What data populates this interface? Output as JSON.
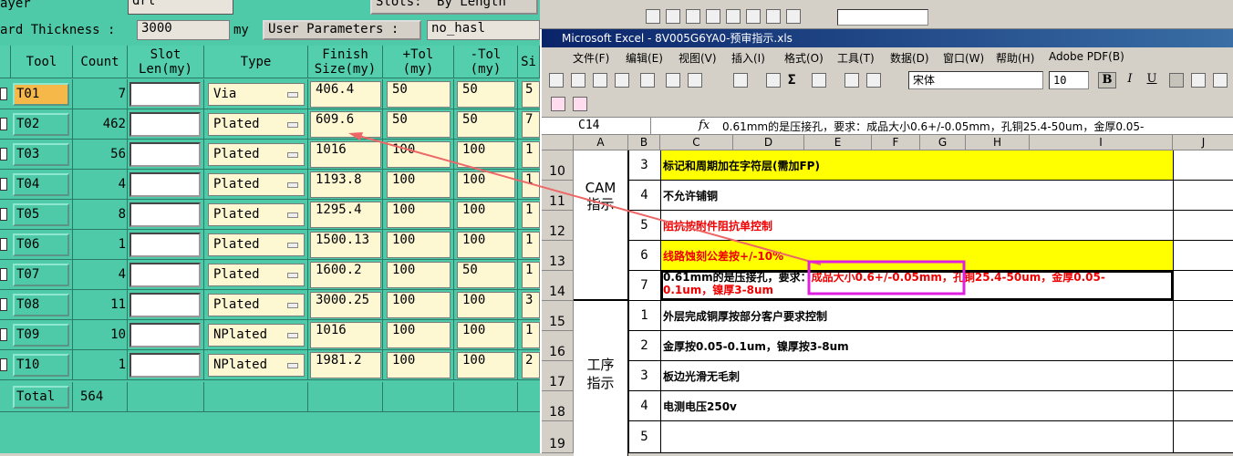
{
  "left_panel": {
    "layer_label": "ayer",
    "layer_value": "drl",
    "slots_label": "Slots:",
    "slots_value": "By Length",
    "board_thickness_label": "ard Thickness :",
    "board_thickness_value": "3000",
    "board_thickness_unit": "my",
    "user_params_label": "User Parameters :",
    "user_params_value": "no_hasl",
    "headers": [
      "Tool",
      "Count",
      "Slot\nLen(my)",
      "Type",
      "Finish\nSize(my)",
      "+Tol\n(my)",
      "-Tol\n(my)",
      "Si"
    ],
    "header_tool": "Tool",
    "header_count": "Count",
    "header_slot1": "Slot",
    "header_slot2": "Len(my)",
    "header_type": "Type",
    "header_finish1": "Finish",
    "header_finish2": "Size(my)",
    "header_ptol1": "+Tol",
    "header_ptol2": "(my)",
    "header_mtol1": "-Tol",
    "header_mtol2": "(my)",
    "header_si": "Si",
    "rows": [
      {
        "tool": "T01",
        "count": "7",
        "type": "Via",
        "finish": "406.4",
        "ptol": "50",
        "mtol": "50",
        "si": "5"
      },
      {
        "tool": "T02",
        "count": "462",
        "type": "Plated",
        "finish": "609.6",
        "ptol": "50",
        "mtol": "50",
        "si": "7"
      },
      {
        "tool": "T03",
        "count": "56",
        "type": "Plated",
        "finish": "1016",
        "ptol": "100",
        "mtol": "100",
        "si": "1"
      },
      {
        "tool": "T04",
        "count": "4",
        "type": "Plated",
        "finish": "1193.8",
        "ptol": "100",
        "mtol": "100",
        "si": "1"
      },
      {
        "tool": "T05",
        "count": "8",
        "type": "Plated",
        "finish": "1295.4",
        "ptol": "100",
        "mtol": "100",
        "si": "1"
      },
      {
        "tool": "T06",
        "count": "1",
        "type": "Plated",
        "finish": "1500.13",
        "ptol": "100",
        "mtol": "100",
        "si": "1"
      },
      {
        "tool": "T07",
        "count": "4",
        "type": "Plated",
        "finish": "1600.2",
        "ptol": "100",
        "mtol": "50",
        "si": "1"
      },
      {
        "tool": "T08",
        "count": "11",
        "type": "Plated",
        "finish": "3000.25",
        "ptol": "100",
        "mtol": "100",
        "si": "3"
      },
      {
        "tool": "T09",
        "count": "10",
        "type": "NPlated",
        "finish": "1016",
        "ptol": "100",
        "mtol": "100",
        "si": "1"
      },
      {
        "tool": "T10",
        "count": "1",
        "type": "NPlated",
        "finish": "1981.2",
        "ptol": "100",
        "mtol": "100",
        "si": "2"
      }
    ],
    "total_label": "Total",
    "total_value": "564"
  },
  "excel": {
    "title": "Microsoft Excel - 8V005G6YA0-预审指示.xls",
    "menu": [
      "文件(F)",
      "编辑(E)",
      "视图(V)",
      "插入(I)",
      "格式(O)",
      "工具(T)",
      "数据(D)",
      "窗口(W)",
      "帮助(H)",
      "Adobe PDF(B)"
    ],
    "font_name": "宋体",
    "font_size": "10",
    "cell_ref": "C14",
    "fx": "fx",
    "formula": "0.61mm的是压接孔，要求：成品大小0.6+/-0.05mm，孔铜25.4-50um，金厚0.05-",
    "columns": [
      "A",
      "B",
      "C",
      "D",
      "E",
      "F",
      "G",
      "H",
      "I",
      "J"
    ],
    "row_numbers": [
      "10",
      "11",
      "12",
      "13",
      "14",
      "15",
      "16",
      "17",
      "18",
      "19"
    ],
    "group1_label": "CAM\n指示",
    "group1_l1": "CAM",
    "group1_l2": "指示",
    "group2_l1": "工序",
    "group2_l2": "指示",
    "rows": [
      {
        "num": "3",
        "text": "标记和周期加在字符层(需加FP)"
      },
      {
        "num": "4",
        "text": "不允许铺铜"
      },
      {
        "num": "5",
        "text": "阻抗按附件阻抗单控制"
      },
      {
        "num": "6",
        "text": "线路蚀刻公差按+/-10%"
      },
      {
        "num": "7",
        "text_a": "0.61mm的是压接孔，要求：",
        "text_b": "成品大小0.6+/-0.05mm，",
        "text_c": "孔铜25.4-50um，金厚0.05-",
        "text_d": "0.1um，镍厚3-8um"
      },
      {
        "num": "1",
        "text": "外层完成铜厚按部分客户要求控制"
      },
      {
        "num": "2",
        "text": "金厚按0.05-0.1um，镍厚按3-8um"
      },
      {
        "num": "3",
        "text": "板边光滑无毛刺"
      },
      {
        "num": "4",
        "text": "电测电压250v"
      },
      {
        "num": "5",
        "text": ""
      }
    ]
  }
}
